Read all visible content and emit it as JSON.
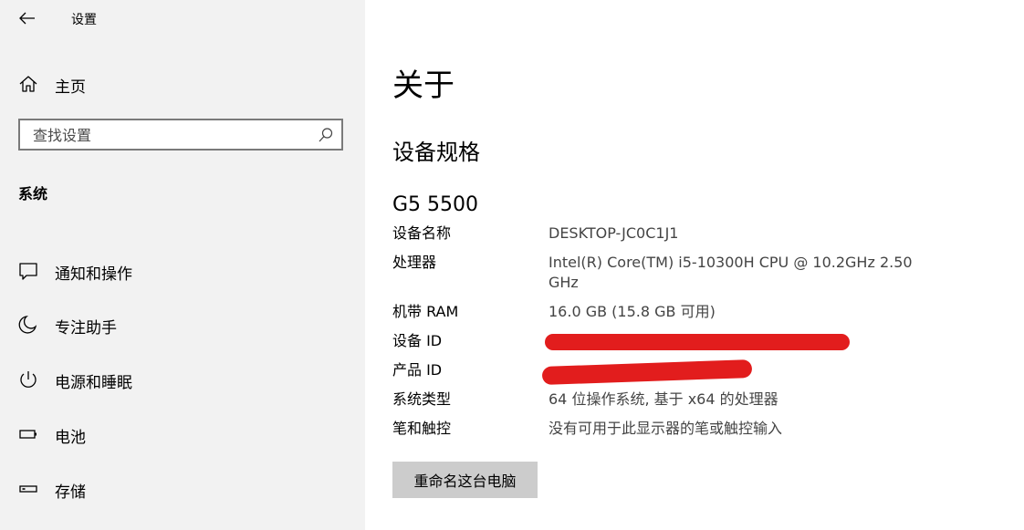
{
  "window": {
    "title": "设置"
  },
  "sidebar": {
    "home_label": "主页",
    "search_placeholder": "查找设置",
    "section_title": "系统",
    "items": [
      {
        "label": "通知和操作",
        "icon": "notification-icon"
      },
      {
        "label": "专注助手",
        "icon": "moon-icon"
      },
      {
        "label": "电源和睡眠",
        "icon": "power-icon"
      },
      {
        "label": "电池",
        "icon": "battery-icon"
      },
      {
        "label": "存储",
        "icon": "storage-icon"
      }
    ]
  },
  "main": {
    "page_title": "关于",
    "section_heading": "设备规格",
    "model_name": "G5 5500",
    "specs": [
      {
        "key": "设备名称",
        "value": "DESKTOP-JC0C1J1"
      },
      {
        "key": "处理器",
        "value": "Intel(R) Core(TM) i5-10300H CPU @ 10.2GHz   2.50 GHz"
      },
      {
        "key": "机带 RAM",
        "value": "16.0 GB (15.8 GB 可用)"
      },
      {
        "key": "设备 ID",
        "value": ""
      },
      {
        "key": "产品 ID",
        "value": ""
      },
      {
        "key": "系统类型",
        "value": "64 位操作系统, 基于 x64 的处理器"
      },
      {
        "key": "笔和触控",
        "value": "没有可用于此显示器的笔或触控输入"
      }
    ],
    "rename_button": "重命名这台电脑"
  },
  "colors": {
    "sidebar_bg": "#f2f2f2",
    "button_bg": "#cccccc",
    "redaction": "#e21d1d"
  }
}
